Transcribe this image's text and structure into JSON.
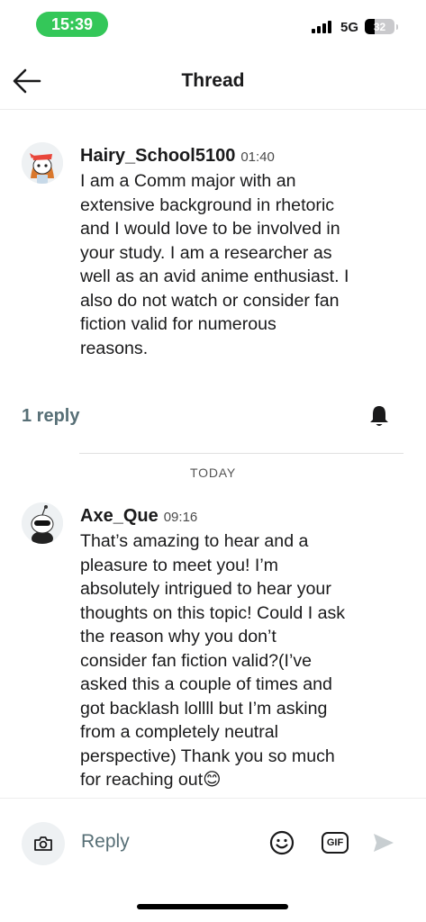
{
  "status_bar": {
    "time": "15:39",
    "network": "5G",
    "battery": "32"
  },
  "header": {
    "title": "Thread"
  },
  "comments": [
    {
      "username": "Hairy_School5100",
      "time": "01:40",
      "lines": [
        "I am a Comm major with an",
        "extensive background in rhetoric",
        "and I would love to be involved in",
        "your study. I am a researcher as",
        "well as an avid anime enthusiast. I",
        "also do not watch or consider fan",
        "fiction valid for numerous",
        "reasons."
      ]
    },
    {
      "username": "Axe_Que",
      "time": "09:16",
      "lines": [
        "That’s amazing to hear and a",
        "pleasure to meet you! I’m",
        "absolutely intrigued to hear your",
        "thoughts on this topic! Could I ask",
        "the reason why you don’t",
        "consider fan fiction valid?(I’ve",
        "asked this a couple of times and",
        "got backlash lollll but I’m asking",
        "from a completely neutral",
        "perspective) Thank you so much",
        "for reaching out😊"
      ]
    }
  ],
  "thread": {
    "reply_count": "1 reply",
    "day_separator": "TODAY"
  },
  "composer": {
    "placeholder": "Reply",
    "gif_label": "GIF"
  },
  "colors": {
    "time_pill": "#34c759",
    "muted_text": "#576f76"
  }
}
